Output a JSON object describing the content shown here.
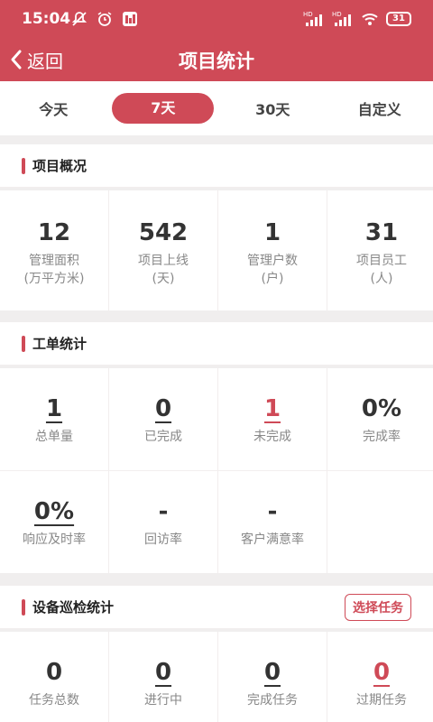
{
  "status_bar": {
    "time": "15:04",
    "battery": "31",
    "signal_badge_1": "HD",
    "signal_badge_2": "HD"
  },
  "nav": {
    "back_label": "返回",
    "title": "项目统计"
  },
  "tabs": [
    {
      "label": "今天",
      "active": false
    },
    {
      "label": "7天",
      "active": true
    },
    {
      "label": "30天",
      "active": false
    },
    {
      "label": "自定义",
      "active": false
    }
  ],
  "overview": {
    "title": "项目概况",
    "items": [
      {
        "value": "12",
        "label": "管理面积",
        "unit": "(万平方米)"
      },
      {
        "value": "542",
        "label": "项目上线",
        "unit": "(天)"
      },
      {
        "value": "1",
        "label": "管理户数",
        "unit": "(户)"
      },
      {
        "value": "31",
        "label": "项目员工",
        "unit": "(人)"
      }
    ]
  },
  "workorder": {
    "title": "工单统计",
    "items": [
      {
        "value": "1",
        "label": "总单量"
      },
      {
        "value": "0",
        "label": "已完成"
      },
      {
        "value": "1",
        "label": "未完成"
      },
      {
        "value": "0%",
        "label": "完成率"
      },
      {
        "value": "0%",
        "label": "响应及时率"
      },
      {
        "value": "-",
        "label": "回访率"
      },
      {
        "value": "-",
        "label": "客户满意率"
      }
    ]
  },
  "inspection": {
    "title": "设备巡检统计",
    "select_button": "选择任务",
    "items": [
      {
        "value": "0",
        "label": "任务总数"
      },
      {
        "value": "0",
        "label": "进行中"
      },
      {
        "value": "0",
        "label": "完成任务"
      },
      {
        "value": "0",
        "label": "过期任务"
      }
    ]
  },
  "colors": {
    "brand": "#cf4a57",
    "text": "#333333",
    "label": "#888888"
  }
}
